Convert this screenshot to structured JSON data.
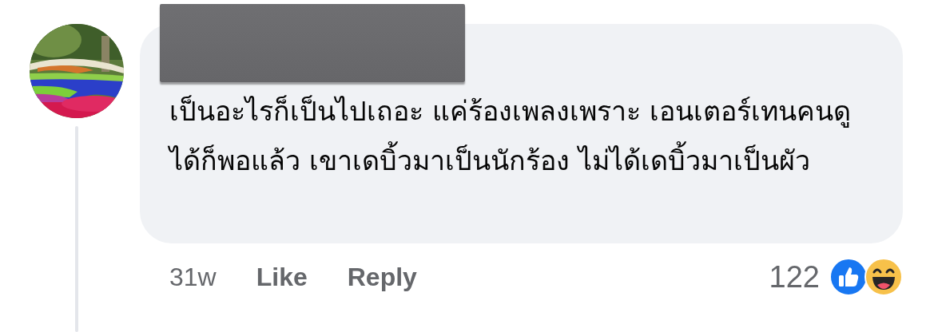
{
  "comment": {
    "text": "เป็นอะไรก็เป็นไปเถอะ แค่ร้องเพลงเพราะ เอนเตอร์เทนคนดูได้ก็พอแล้ว เขาเดบิ้วมาเป็นนักร้อง ไม่ได้เดบิ้วมาเป็นผัว",
    "time": "31w"
  },
  "actions": [
    "Like",
    "Reply"
  ],
  "reactions": {
    "count": "122"
  }
}
